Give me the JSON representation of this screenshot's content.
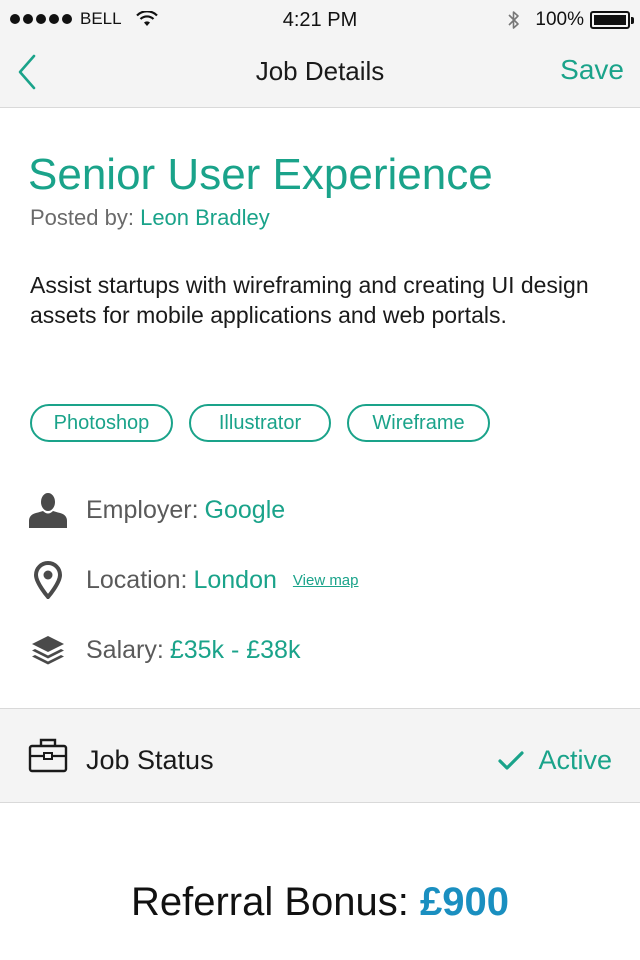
{
  "status_bar": {
    "carrier": "BELL",
    "time": "4:21 PM",
    "battery": "100%",
    "battery_level": 1.0
  },
  "nav": {
    "back_icon": "chevron-left-icon",
    "title": "Job Details",
    "save_label": "Save"
  },
  "job": {
    "title": "Senior User Experience",
    "posted_by_label": "Posted by:",
    "posted_by_name": "Leon Bradley",
    "description": "Assist startups with wireframing and creating UI design assets for mobile applications and web portals.",
    "tags": [
      "Photoshop",
      "Illustrator",
      "Wireframe"
    ]
  },
  "details": {
    "employer": {
      "icon": "person-icon",
      "label": "Employer:",
      "value": "Google"
    },
    "location": {
      "icon": "map-pin-icon",
      "label": "Location:",
      "value": "London",
      "link": "View map"
    },
    "salary": {
      "icon": "layers-icon",
      "label": "Salary:",
      "value": "£35k - £38k"
    }
  },
  "job_status": {
    "icon": "briefcase-icon",
    "label": "Job Status",
    "value": "Active"
  },
  "referral": {
    "label": "Referral Bonus:",
    "amount": "£900"
  },
  "colors": {
    "accent": "#1aa38a",
    "bonus": "#1a8fc0",
    "bar_background": "#f4f4f4"
  }
}
